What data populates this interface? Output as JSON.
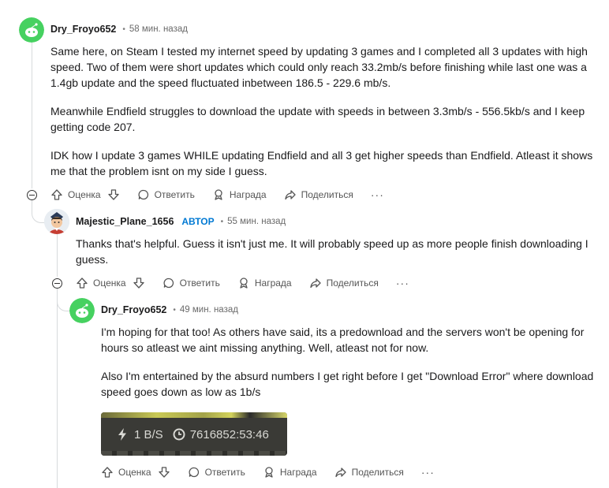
{
  "comments": [
    {
      "username": "Dry_Froyo652",
      "time": "58 мин. назад",
      "paragraphs": [
        "Same here, on Steam I tested my internet speed by updating 3 games and I completed all 3 updates with high speed. Two of them were short updates which could only reach 33.2mb/s before finishing while last one was a 1.4gb update and the speed fluctuated inbetween 186.5 - 229.6 mb/s.",
        "Meanwhile Endfield struggles to download the update with speeds in between 3.3mb/s - 556.5kb/s and I keep getting code 207.",
        "IDK how I update 3 games WHILE updating Endfield and all 3 get higher speeds than Endfield. Atleast it shows me that the problem isnt on my side I guess."
      ]
    },
    {
      "username": "Majestic_Plane_1656",
      "op_badge": "АВТОР",
      "time": "55 мин. назад",
      "paragraphs": [
        "Thanks that's helpful. Guess it isn't just me. It will probably speed up as more people finish downloading I guess."
      ]
    },
    {
      "username": "Dry_Froyo652",
      "time": "49 мин. назад",
      "paragraphs": [
        "I'm hoping for that too! As others have said, its a predownload and the servers won't be opening for hours so atleast we aint missing anything. Well, atleast not for now.",
        "Also I'm entertained by the absurd numbers I get right before I get \"Download Error\" where download speed goes down as low as 1b/s"
      ],
      "image": {
        "speed": "1 B/S",
        "timer": "7616852:53:46"
      }
    }
  ],
  "actions": {
    "score": "Оценка",
    "reply": "Ответить",
    "award": "Награда",
    "share": "Поделиться",
    "more": "···"
  },
  "colors": {
    "op_badge": "#0079d3",
    "avatar_green": "#46d160"
  }
}
